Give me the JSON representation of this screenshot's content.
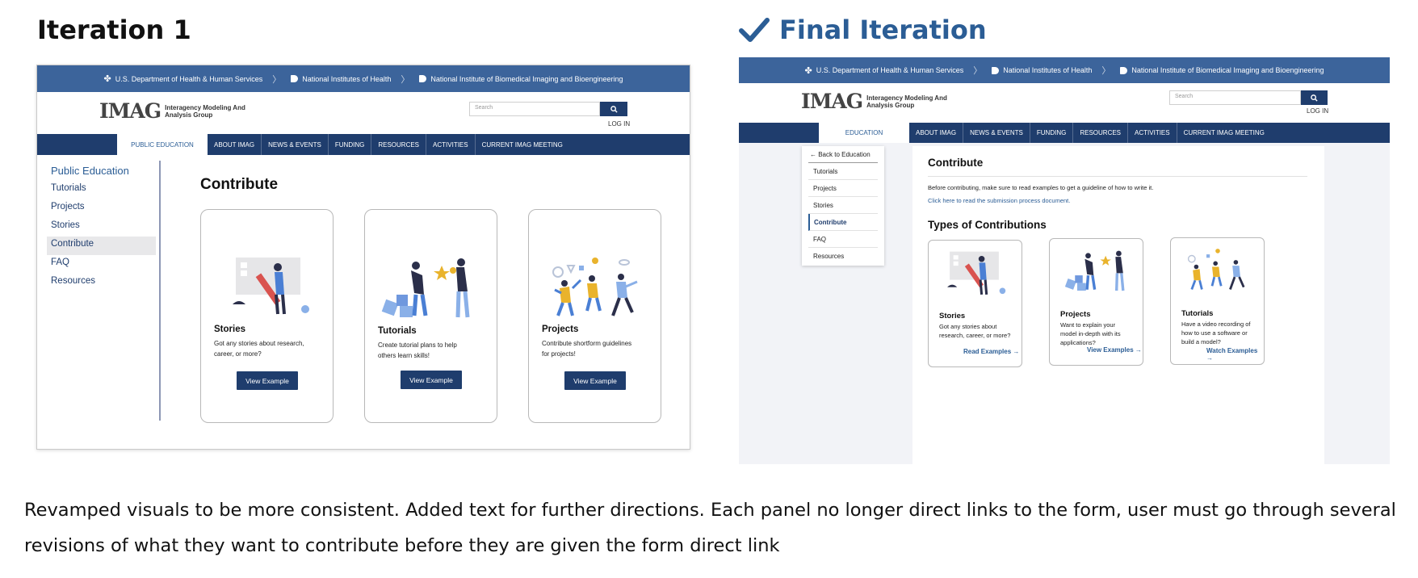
{
  "headings": {
    "iteration1": "Iteration 1",
    "final": "Final Iteration",
    "final_icon": "checkmark-icon"
  },
  "hhs_bar": {
    "crumbs": [
      "U.S. Department of Health & Human Services",
      "National Institutes of Health",
      "National Institute of Biomedical Imaging and Bioengineering"
    ]
  },
  "brand": {
    "mark": "IMAG",
    "line1": "Interagency Modeling And",
    "line2": "Analysis Group",
    "search_placeholder": "Search",
    "login": "LOG IN"
  },
  "iteration1": {
    "nav": [
      "PUBLIC EDUCATION",
      "ABOUT IMAG",
      "NEWS & EVENTS",
      "FUNDING",
      "RESOURCES",
      "ACTIVITIES",
      "CURRENT IMAG MEETING"
    ],
    "sidebar": [
      "Public Education",
      "Tutorials",
      "Projects",
      "Stories",
      "Contribute",
      "FAQ",
      "Resources"
    ],
    "title": "Contribute",
    "cards": [
      {
        "title": "Stories",
        "desc1": "Got any stories about research,",
        "desc2": "career, or more?",
        "button": "View Example"
      },
      {
        "title": "Tutorials",
        "desc1": "Create tutorial plans to help",
        "desc2": "others learn skills!",
        "button": "View Example"
      },
      {
        "title": "Projects",
        "desc1": "Contribute shortform guidelines",
        "desc2": "for projects!",
        "button": "View Example"
      }
    ]
  },
  "final": {
    "nav": [
      "EDUCATION",
      "ABOUT IMAG",
      "NEWS & EVENTS",
      "FUNDING",
      "RESOURCES",
      "ACTIVITIES",
      "CURRENT IMAG MEETING"
    ],
    "back_link": "← Back to Education",
    "sidebar": [
      "Tutorials",
      "Projects",
      "Stories",
      "Contribute",
      "FAQ",
      "Resources"
    ],
    "title": "Contribute",
    "intro": "Before contributing, make sure to read examples to get a guideline of how to write it.",
    "doc_link": "Click here to read the submission process document.",
    "types_title": "Types of Contributions",
    "cards": [
      {
        "title": "Stories",
        "desc": [
          "Got any stories about",
          "research, career, or more?"
        ],
        "link": "Read Examples →"
      },
      {
        "title": "Projects",
        "desc": [
          "Want to explain your",
          "model in-depth with its",
          "applications?"
        ],
        "link": "View Examples →"
      },
      {
        "title": "Tutorials",
        "desc": [
          "Have a video recording of",
          "how to use a software or",
          "build a model?"
        ],
        "link": "Watch Examples →"
      }
    ]
  },
  "caption": {
    "line1": "Revamped visuals to be more consistent. Added text for further directions. Each panel no longer direct links to the form, user must go through several",
    "line2": "revisions of what they want to contribute before they are given the form direct link"
  },
  "colors": {
    "header_blue": "#3c649b",
    "nav_navy": "#1f3d6d",
    "accent_blue": "#2b5d95",
    "illustration_yellow": "#e9b32c",
    "illustration_red": "#d9534f"
  }
}
